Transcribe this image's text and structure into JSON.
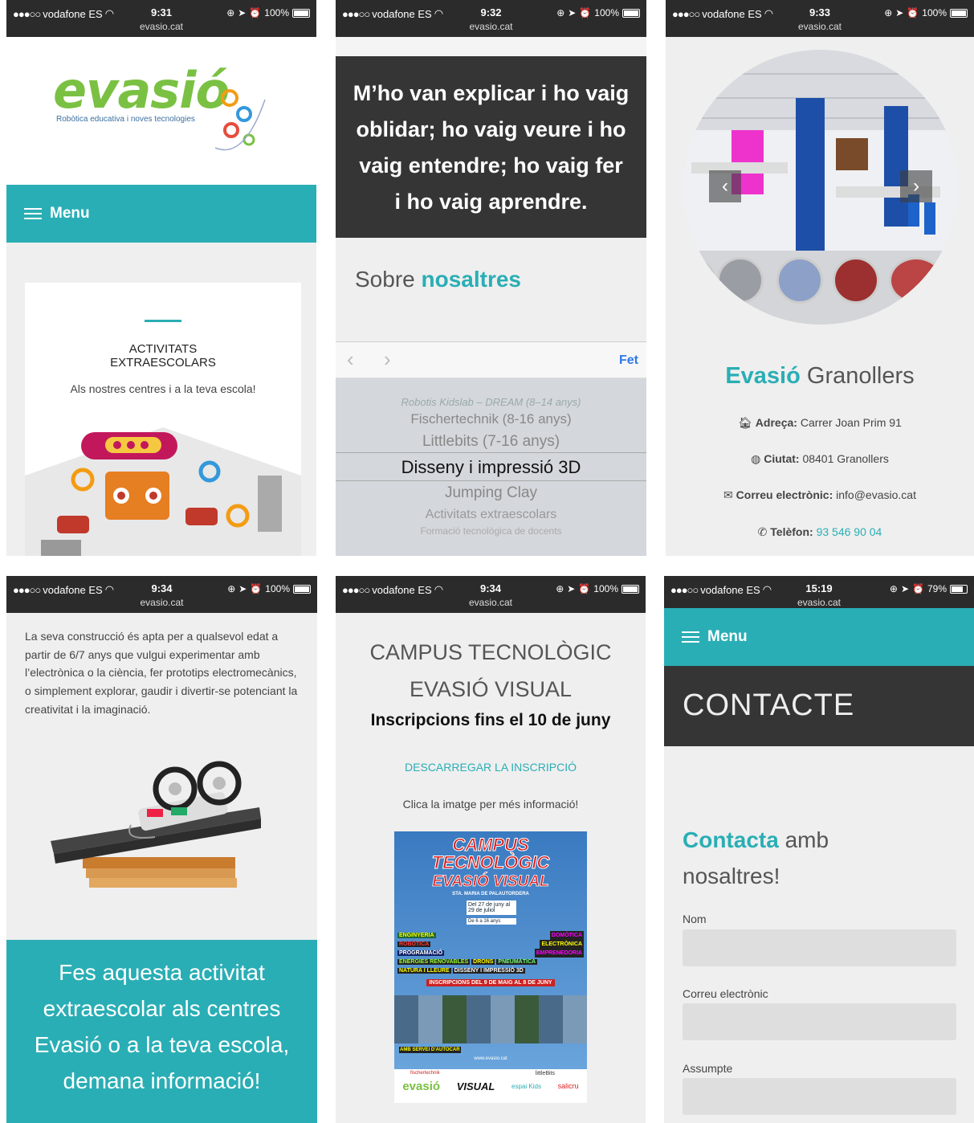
{
  "status": {
    "carrier": "vodafone ES",
    "url": "evasio.cat",
    "times": [
      "9:31",
      "9:32",
      "9:33",
      "9:34",
      "9:34",
      "15:19"
    ],
    "batteries": [
      "100%",
      "100%",
      "100%",
      "100%",
      "100%",
      "79%"
    ],
    "battery_levels": [
      1,
      1,
      1,
      1,
      1,
      0.79
    ]
  },
  "p1": {
    "logo_text": "evasió",
    "logo_tagline": "Robòtica educativa i noves tecnologies",
    "menu_label": "Menu",
    "card_title_line1": "ACTIVITATS",
    "card_title_line2": "EXTRAESCOLARS",
    "card_subtitle": "Als nostres centres i a la teva escola!"
  },
  "p2": {
    "quote_lines": [
      "M’ho van explicar i ho vaig",
      "oblidar; ho vaig veure i ho",
      "vaig entendre; ho vaig fer",
      "i ho vaig aprendre."
    ],
    "section_word1": "Sobre ",
    "section_word2": "nosaltres",
    "done_label": "Fet",
    "picker_items": [
      "Robotis Kidslab – DREAM (8–14 anys)",
      "Fischertechnik (8-16 anys)",
      "Littlebits (7-16 anys)",
      "Disseny i impressió 3D",
      "Jumping Clay",
      "Activitats extraescolars",
      "Formació tecnològica de docents"
    ],
    "picker_selected": "Disseny i impressió 3D"
  },
  "p3": {
    "title_teal": "Evasió",
    "title_rest": " Granollers",
    "address_label": "Adreça:",
    "address_value": "Carrer Joan Prim 91",
    "city_label": "Ciutat:",
    "city_value": "08401 Granollers",
    "email_label": "Correu electrònic:",
    "email_value": "info@evasio.cat",
    "phone_label": "Telèfon:",
    "phone_value": "93 546 90 04"
  },
  "p4": {
    "paragraph": "La seva construcció és apta per a qualsevol edat a partir de 6/7 anys que vulgui experimentar amb l’electrònica o la ciència, fer prototips electromecànics, o simplement explorar, gaudir i divertir-se potenciant la creativitat i la imaginació.",
    "cta": "Fes aquesta activitat extraescolar als centres Evasió o a la teva escola, demana informació!"
  },
  "p5": {
    "title_line1": "CAMPUS TECNOLÒGIC",
    "title_line2": "EVASIÓ VISUAL",
    "subtitle": "Inscripcions fins el 10 de juny",
    "download_link": "DESCARREGAR LA INSCRIPCIÓ",
    "hint": "Clica la imatge per més informació!",
    "poster": {
      "headline1": "CAMPUS",
      "headline2": "TECNOLÒGIC",
      "headline3": "EVASIÓ VISUAL",
      "place": "STA. MARIA DE PALAUTORDERA",
      "dates": "Del 27 de juny al 29 de juliol",
      "ages": "De 6 a 16 anys",
      "topics": [
        "ENGINYERIA",
        "DOMÒTICA",
        "ROBÒTICA",
        "ELECTRÒNICA",
        "PROGRAMACIÓ",
        "EMPRENEDORIA",
        "ENERGIES RENOVABLES",
        "DRONS",
        "PNEUMÀTICA",
        "NATURA I LLEURE",
        "DISSENY I IMPRESSIÓ 3D"
      ],
      "inscriptions": "INSCRIPCIONS DEL 9 DE MAIG AL 8 DE JUNY",
      "bus": "AMB SERVEI D'AUTOCAR",
      "website": "www.evasio.cat",
      "footer_logos": [
        "evasió",
        "VISUAL",
        "espai Kids",
        "salicru",
        "littleBits",
        "fischertechnik"
      ]
    }
  },
  "p6": {
    "menu_label": "Menu",
    "header": "CONTACTE",
    "heading_teal": "Contacta",
    "heading_rest": " amb nosaltres!",
    "fields": [
      "Nom",
      "Correu electrònic",
      "Assumpte"
    ]
  },
  "colors": {
    "teal": "#2aaeb5",
    "dark": "#353535",
    "green": "#7ac143"
  }
}
